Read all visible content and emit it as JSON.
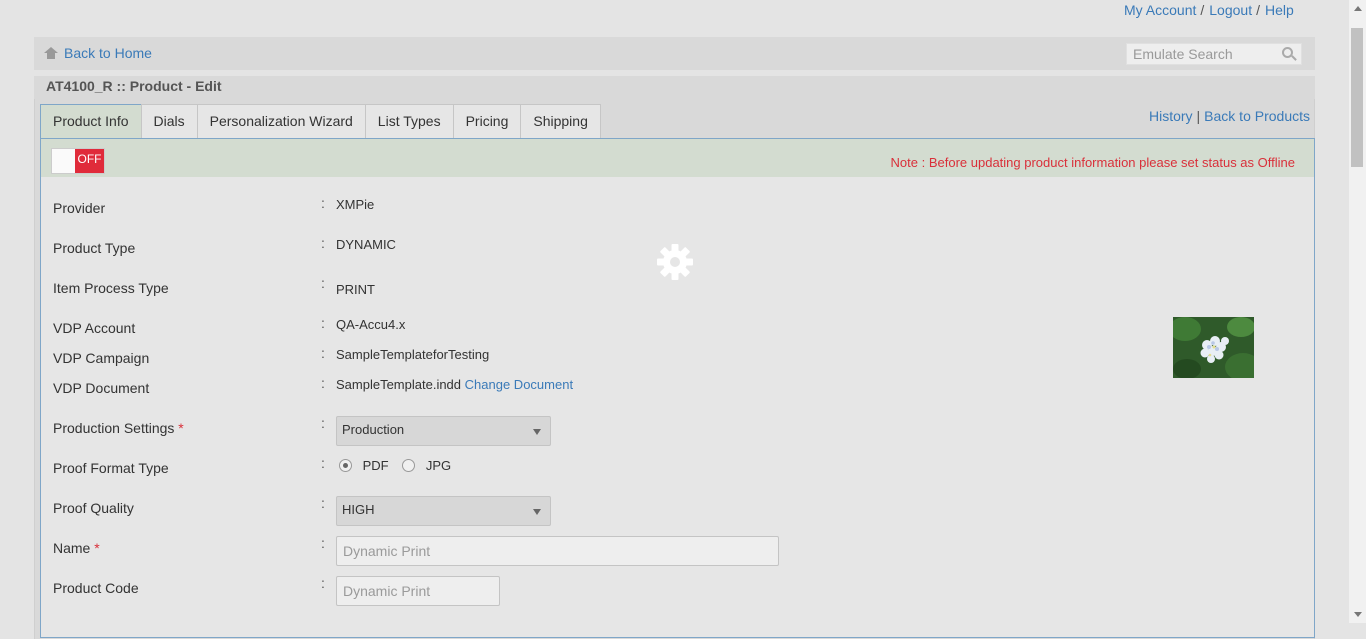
{
  "top_links": {
    "my_account": "My Account",
    "logout": "Logout",
    "help": "Help",
    "separator": "/"
  },
  "home_bar": {
    "back_to_home": "Back to Home",
    "search_placeholder": "Emulate Search"
  },
  "page_title": "AT4100_R :: Product - Edit",
  "tabs": [
    {
      "label": "Product Info",
      "active": true
    },
    {
      "label": "Dials",
      "active": false
    },
    {
      "label": "Personalization Wizard",
      "active": false
    },
    {
      "label": "List Types",
      "active": false
    },
    {
      "label": "Pricing",
      "active": false
    },
    {
      "label": "Shipping",
      "active": false
    }
  ],
  "right_links": {
    "history": "History",
    "separator": "|",
    "back_to_products": "Back to Products"
  },
  "status": {
    "toggle_state": "OFF",
    "note": "Note : Before updating product information please set status as Offline"
  },
  "fields": {
    "colon": ":",
    "provider": {
      "label": "Provider",
      "value": "XMPie"
    },
    "product_type": {
      "label": "Product Type",
      "value": "DYNAMIC"
    },
    "item_process_type": {
      "label": "Item Process Type",
      "value": "PRINT"
    },
    "vdp_account": {
      "label": "VDP Account",
      "value": "QA-Accu4.x"
    },
    "vdp_campaign": {
      "label": "VDP Campaign",
      "value": "SampleTemplateforTesting"
    },
    "vdp_document": {
      "label": "VDP Document",
      "value": "SampleTemplate.indd",
      "action": "Change Document"
    },
    "production_settings": {
      "label": "Production Settings",
      "required_mark": "*",
      "selected": "Production"
    },
    "proof_format_type": {
      "label": "Proof Format Type",
      "options": [
        "PDF",
        "JPG"
      ],
      "selected": "PDF"
    },
    "proof_quality": {
      "label": "Proof Quality",
      "selected": "HIGH"
    },
    "name": {
      "label": "Name",
      "required_mark": "*",
      "placeholder": "Dynamic Print"
    },
    "product_code": {
      "label": "Product Code",
      "placeholder": "Dynamic Print"
    }
  },
  "icons": {
    "home": "home-icon",
    "search": "search-icon",
    "loading": "gear-icon",
    "product_image": "hydrangea-flower-thumbnail"
  },
  "colors": {
    "link": "#3a7ab8",
    "required": "#d9303a",
    "toggle_off": "#e02b3a",
    "tab_active_bg": "#d3dcd0"
  }
}
